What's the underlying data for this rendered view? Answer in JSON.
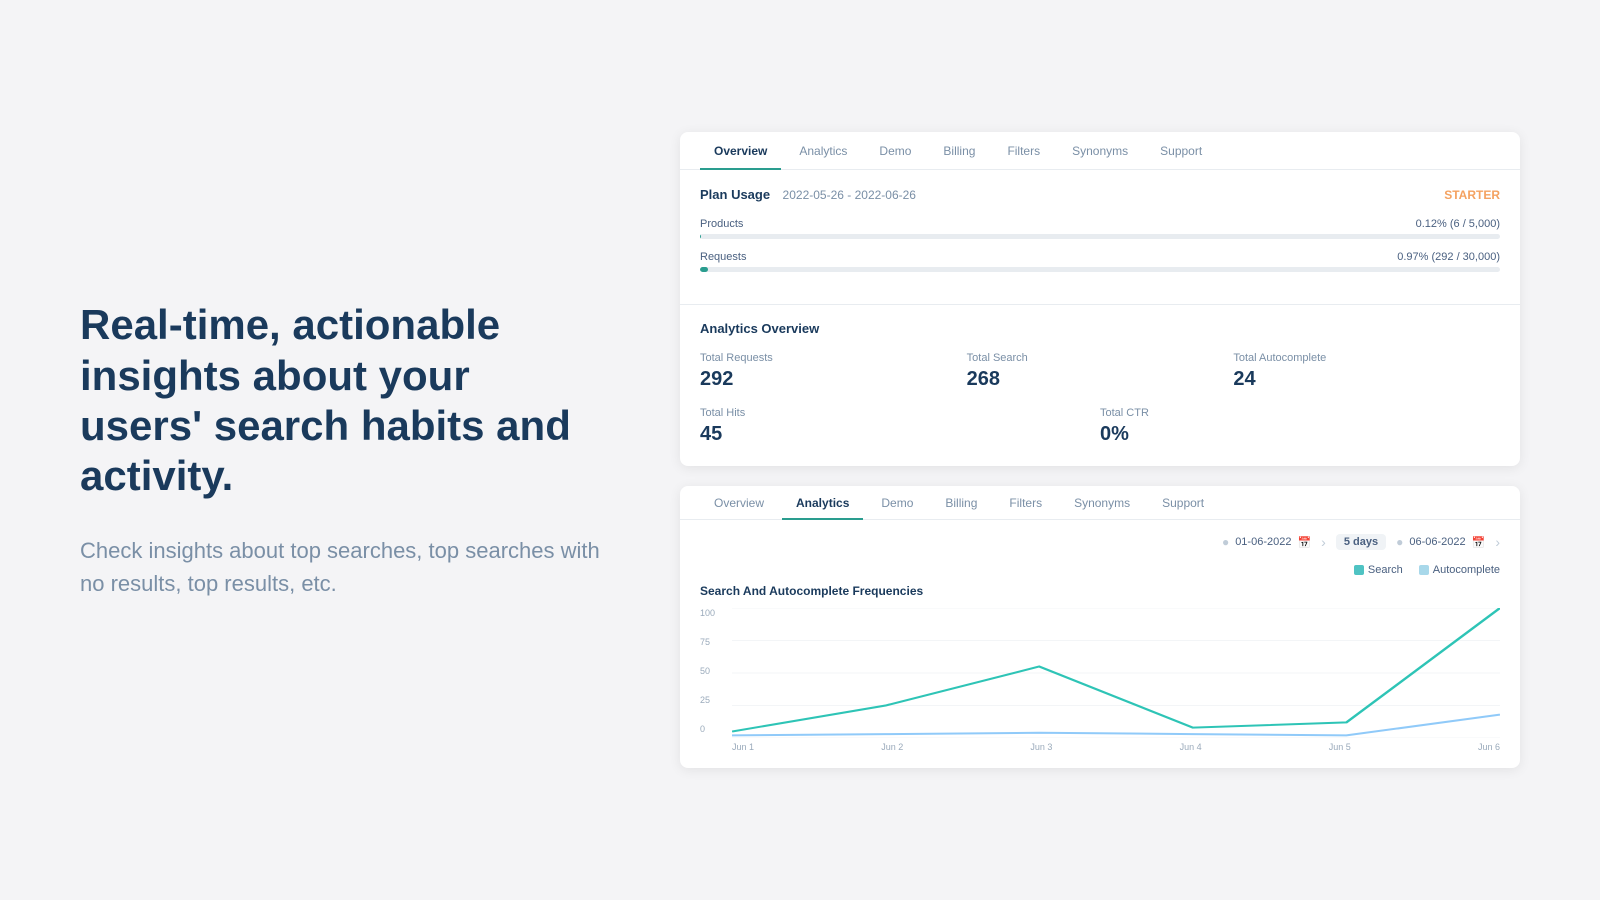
{
  "left": {
    "headline": "Real-time, actionable insights about your users' search habits and activity.",
    "subtext": "Check insights about top searches, top searches with no results, top results, etc."
  },
  "topCard": {
    "tabs": [
      {
        "label": "Overview",
        "active": true
      },
      {
        "label": "Analytics",
        "active": false
      },
      {
        "label": "Demo",
        "active": false
      },
      {
        "label": "Billing",
        "active": false
      },
      {
        "label": "Filters",
        "active": false
      },
      {
        "label": "Synonyms",
        "active": false
      },
      {
        "label": "Support",
        "active": false
      }
    ],
    "planUsage": {
      "title": "Plan Usage",
      "dateRange": "2022-05-26 - 2022-06-26",
      "badge": "STARTER"
    },
    "products": {
      "label": "Products",
      "valueText": "0.12% (6 / 5,000)",
      "percent": 0.12
    },
    "requests": {
      "label": "Requests",
      "valueText": "0.97% (292 / 30,000)",
      "percent": 0.97
    }
  },
  "analyticsCard": {
    "title": "Analytics Overview",
    "stats": [
      {
        "label": "Total Requests",
        "value": "292"
      },
      {
        "label": "Total Search",
        "value": "268"
      },
      {
        "label": "Total Autocomplete",
        "value": "24"
      },
      {
        "label": "Total Hits",
        "value": "45"
      },
      {
        "label": "Total CTR",
        "value": "0%"
      }
    ]
  },
  "bottomCard": {
    "tabs": [
      {
        "label": "Overview",
        "active": false
      },
      {
        "label": "Analytics",
        "active": true
      },
      {
        "label": "Demo",
        "active": false
      },
      {
        "label": "Billing",
        "active": false
      },
      {
        "label": "Filters",
        "active": false
      },
      {
        "label": "Synonyms",
        "active": false
      },
      {
        "label": "Support",
        "active": false
      }
    ],
    "dateFrom": "01-06-2022",
    "dateTo": "06-06-2022",
    "daysBetween": "5 days",
    "chartTitle": "Search And Autocomplete Frequencies",
    "legend": [
      {
        "label": "Search",
        "color": "search"
      },
      {
        "label": "Autocomplete",
        "color": "autocomplete"
      }
    ],
    "yLabels": [
      "100",
      "75",
      "50",
      "25",
      "0"
    ],
    "xLabels": [
      "Jun 1",
      "Jun 2",
      "Jun 3",
      "Jun 4",
      "Jun 5",
      "Jun 6"
    ]
  }
}
